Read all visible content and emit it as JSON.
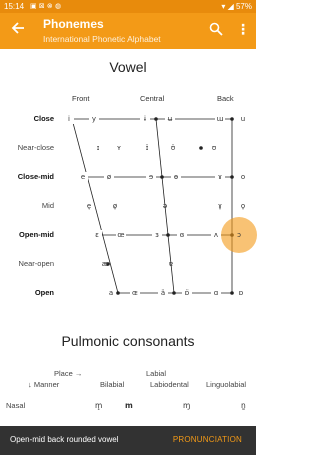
{
  "status_bar": {
    "time": "15:14",
    "left_icons": "▣ ⊠ ⊗ ◍",
    "battery": "57%"
  },
  "app_bar": {
    "title": "Phonemes",
    "subtitle": "International Phonetic Alphabet"
  },
  "vowel_section": {
    "title": "Vowel",
    "columns": [
      "Front",
      "Central",
      "Back"
    ],
    "rows": [
      {
        "label": "Close",
        "bold": true
      },
      {
        "label": "Near-close",
        "bold": false
      },
      {
        "label": "Close-mid",
        "bold": true
      },
      {
        "label": "Mid",
        "bold": false
      },
      {
        "label": "Open-mid",
        "bold": true
      },
      {
        "label": "Near-open",
        "bold": false
      },
      {
        "label": "Open",
        "bold": true
      }
    ],
    "vowels": {
      "close": [
        "i",
        "y",
        "ɨ",
        "ʉ",
        "ɯ",
        "u"
      ],
      "near_close": [
        "ɪ",
        "ʏ",
        "ɪ̈",
        "ʊ̈",
        "ʊ"
      ],
      "close_mid": [
        "e",
        "ø",
        "ɘ",
        "ɵ",
        "ɤ",
        "o"
      ],
      "mid": [
        "e̞",
        "ø̞",
        "ə",
        "ɤ̞",
        "o̞"
      ],
      "open_mid": [
        "ɛ",
        "œ",
        "ɜ",
        "ɞ",
        "ʌ",
        "ɔ"
      ],
      "near_open": [
        "æ",
        "ɐ"
      ],
      "open": [
        "a",
        "ɶ",
        "ä",
        "ɒ̈",
        "ɑ",
        "ɒ"
      ]
    }
  },
  "consonant_section": {
    "title": "Pulmonic consonants",
    "place_label": "Place →",
    "manner_label": "↓ Manner",
    "columns": [
      "Bilabial",
      "Labial",
      "Labiodental",
      "Linguolabial"
    ],
    "rows": [
      {
        "label": "Nasal",
        "cells": [
          "m̥",
          "m",
          "ɱ",
          "n̼"
        ]
      }
    ]
  },
  "snackbar": {
    "message": "Open-mid back rounded vowel",
    "action": "PRONUNCIATION"
  }
}
